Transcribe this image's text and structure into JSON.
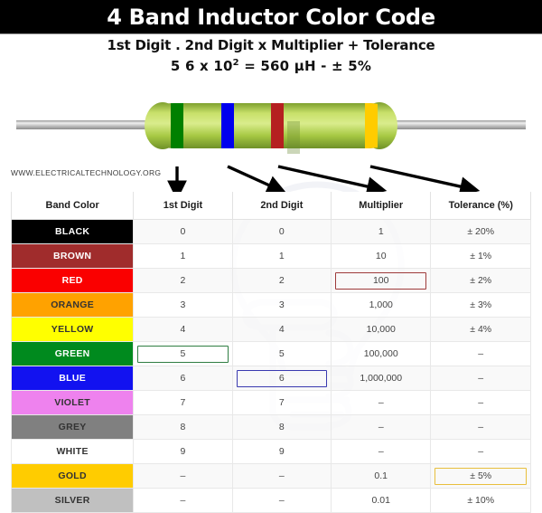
{
  "header": {
    "title": "4 Band Inductor Color Code",
    "subtitle": "1st Digit . 2nd Digit x Multiplier + Tolerance",
    "formula": {
      "digits": "5 6 x 10",
      "exponent": "2",
      "result": " = 560 µH - ± 5%"
    }
  },
  "watermark": {
    "site": "WWW.ELECTRICALTECHNOLOGY.ORG"
  },
  "inductor": {
    "body_color": "#9dc042",
    "lead_color": "#b5b5b5",
    "bands": [
      {
        "name": "band-1-green",
        "color": "#008000",
        "meaning": "1st Digit",
        "value": "5"
      },
      {
        "name": "band-2-blue",
        "color": "#0000ee",
        "meaning": "2nd Digit",
        "value": "6"
      },
      {
        "name": "band-3-red",
        "color": "#b52020",
        "meaning": "Multiplier",
        "value": "100"
      },
      {
        "name": "band-4-gold",
        "color": "#ffcc00",
        "meaning": "Tolerance",
        "value": "± 5%"
      }
    ]
  },
  "table": {
    "headers": [
      "Band Color",
      "1st Digit",
      "2nd Digit",
      "Multiplier",
      "Tolerance (%)"
    ],
    "rows": [
      {
        "color": "BLACK",
        "swatch": "#000000",
        "text": "#ffffff",
        "d1": "0",
        "d2": "0",
        "mul": "1",
        "tol": "± 20%"
      },
      {
        "color": "BROWN",
        "swatch": "#a02c2c",
        "text": "#ffffff",
        "d1": "1",
        "d2": "1",
        "mul": "10",
        "tol": "± 1%"
      },
      {
        "color": "RED",
        "swatch": "#fa0000",
        "text": "#ffffff",
        "d1": "2",
        "d2": "2",
        "mul": "100",
        "tol": "± 2%"
      },
      {
        "color": "ORANGE",
        "swatch": "#ffa200",
        "text": "#333333",
        "d1": "3",
        "d2": "3",
        "mul": "1,000",
        "tol": "± 3%"
      },
      {
        "color": "YELLOW",
        "swatch": "#ffff00",
        "text": "#333333",
        "d1": "4",
        "d2": "4",
        "mul": "10,000",
        "tol": "± 4%"
      },
      {
        "color": "GREEN",
        "swatch": "#008a1e",
        "text": "#ffffff",
        "d1": "5",
        "d2": "5",
        "mul": "100,000",
        "tol": "–"
      },
      {
        "color": "BLUE",
        "swatch": "#1212f0",
        "text": "#ffffff",
        "d1": "6",
        "d2": "6",
        "mul": "1,000,000",
        "tol": "–"
      },
      {
        "color": "VIOLET",
        "swatch": "#ee82ee",
        "text": "#333333",
        "d1": "7",
        "d2": "7",
        "mul": "–",
        "tol": "–"
      },
      {
        "color": "GREY",
        "swatch": "#808080",
        "text": "#333333",
        "d1": "8",
        "d2": "8",
        "mul": "–",
        "tol": "–"
      },
      {
        "color": "WHITE",
        "swatch": "#ffffff",
        "text": "#333333",
        "d1": "9",
        "d2": "9",
        "mul": "–",
        "tol": "–"
      },
      {
        "color": "GOLD",
        "swatch": "#ffcc00",
        "text": "#333333",
        "d1": "–",
        "d2": "–",
        "mul": "0.1",
        "tol": "± 5%"
      },
      {
        "color": "SILVER",
        "swatch": "#c0c0c0",
        "text": "#333333",
        "d1": "–",
        "d2": "–",
        "mul": "0.01",
        "tol": "± 10%"
      }
    ],
    "highlights": {
      "d1_row": 5,
      "d2_row": 6,
      "mul_row": 2,
      "tol_row": 10,
      "d1_color": "#2f7d42",
      "d2_color": "#3a3ab0",
      "mul_color": "#9e3b3b",
      "tol_color": "#e8bf3d"
    }
  }
}
